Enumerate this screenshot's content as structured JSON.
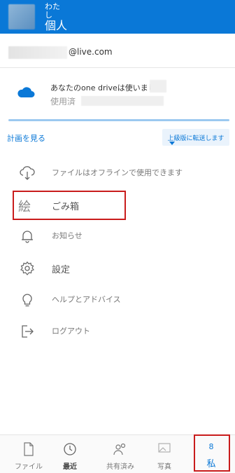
{
  "header": {
    "small_text": "わた\nし",
    "title": "個人",
    "color": "#0a78d7"
  },
  "account": {
    "email_domain": "@live.com"
  },
  "storage": {
    "title": "あなたのone driveは使いました",
    "used_label": "使用済"
  },
  "links": {
    "plan": "計画を見る",
    "upgrade": "上級版に転送します"
  },
  "menu": {
    "offline": "ファイルはオフラインで使用できます",
    "trash_glyph": "絵",
    "trash": "ごみ箱",
    "notifications": "お知らせ",
    "settings": "設定",
    "help": "ヘルプとアドバイス",
    "signout": "ログアウト"
  },
  "bottom_nav": {
    "files": "ファイル",
    "recent": "最近",
    "shared": "共有済み",
    "photos": "写真",
    "me_top": "8",
    "me": "私"
  }
}
